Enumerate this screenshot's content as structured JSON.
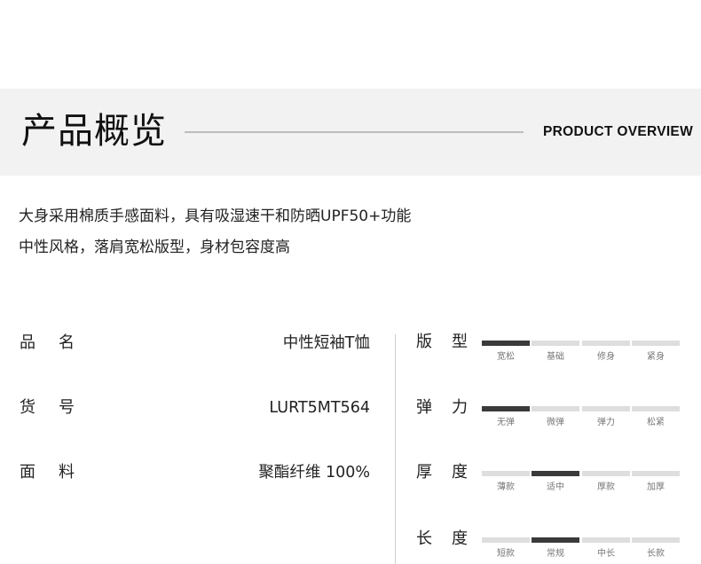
{
  "header": {
    "title": "产品概览",
    "subtitle": "PRODUCT OVERVIEW"
  },
  "description": [
    "大身采用棉质手感面料，具有吸湿速干和防晒UPF50+功能",
    "中性风格，落肩宽松版型，身材包容度高"
  ],
  "specs": [
    {
      "label": "品名",
      "value": "中性短袖T恤"
    },
    {
      "label": "货号",
      "value": "LURT5MT564"
    },
    {
      "label": "面料",
      "value": "聚酯纤维 100%"
    }
  ],
  "attributes": [
    {
      "label": "版型",
      "options": [
        "宽松",
        "基础",
        "修身",
        "紧身"
      ],
      "selected_index": 0
    },
    {
      "label": "弹力",
      "options": [
        "无弹",
        "微弹",
        "弹力",
        "松紧"
      ],
      "selected_index": 0
    },
    {
      "label": "厚度",
      "options": [
        "薄款",
        "适中",
        "厚款",
        "加厚"
      ],
      "selected_index": 1
    },
    {
      "label": "长度",
      "options": [
        "短款",
        "常规",
        "中长",
        "长款"
      ],
      "selected_index": 1
    }
  ],
  "colors": {
    "banner_bg": "#f2f2f2",
    "active_segment": "#3a3a3a",
    "inactive_segment": "#dedede"
  }
}
